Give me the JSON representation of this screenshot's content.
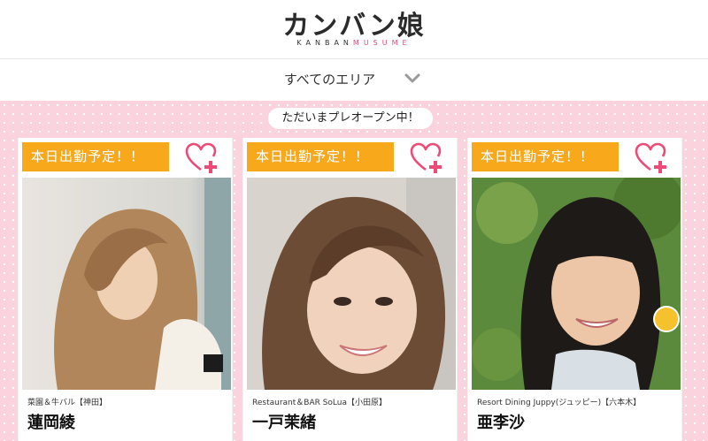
{
  "header": {
    "logo_text": "カンバン娘",
    "logo_sub_kanban": "KANBAN",
    "logo_sub_musume": "MUSUME"
  },
  "area_selector": {
    "label": "すべてのエリア",
    "icon": "chevron-down-icon"
  },
  "notice": {
    "text": "ただいまプレオープン中！"
  },
  "cards": [
    {
      "badge": "本日出勤予定！！",
      "shop": "菜園＆牛バル【神田】",
      "name": "蓮岡綾",
      "favorite_icon": "heart-plus-icon"
    },
    {
      "badge": "本日出勤予定！！",
      "shop": "Restaurant＆BAR SoLua【小田原】",
      "name": "一戸茉緒",
      "favorite_icon": "heart-plus-icon"
    },
    {
      "badge": "本日出勤予定！！",
      "shop": "Resort Dining Juppy(ジュッピー)【六本木】",
      "name": "亜李沙",
      "favorite_icon": "heart-plus-icon"
    }
  ],
  "colors": {
    "badge": "#f7a81b",
    "accent_pink": "#e84a7a",
    "background_pink": "#fbd3de"
  }
}
